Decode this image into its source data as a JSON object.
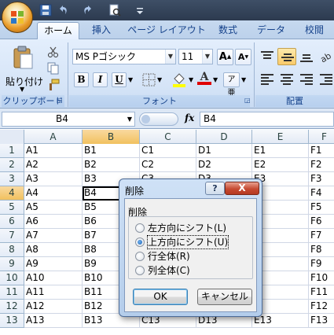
{
  "qat": {
    "icons": [
      "office-logo-icon",
      "save-icon",
      "undo-icon",
      "redo-icon",
      "print-preview-icon",
      "qat-customize-icon"
    ]
  },
  "tabs": [
    {
      "label": "ホーム",
      "active": true
    },
    {
      "label": "挿入",
      "active": false
    },
    {
      "label": "ページ レイアウト",
      "active": false
    },
    {
      "label": "数式",
      "active": false
    },
    {
      "label": "データ",
      "active": false
    },
    {
      "label": "校閲",
      "active": false
    }
  ],
  "ribbon": {
    "clipboard": {
      "paste_label": "貼り付け",
      "group_label": "クリップボード"
    },
    "font": {
      "font_name": "MS Pゴシック",
      "font_size": "11",
      "group_label": "フォント",
      "bold": "B",
      "italic": "I",
      "underline": "U"
    },
    "alignment": {
      "group_label": "配置"
    }
  },
  "formula_bar": {
    "name_box": "B4",
    "fx": "fx",
    "content": "B4"
  },
  "sheet": {
    "columns": [
      "A",
      "B",
      "C",
      "D",
      "E",
      "F"
    ],
    "selected_column": "B",
    "selected_row": "4",
    "active_cell": "B4",
    "rows": [
      {
        "num": "1",
        "cells": [
          "A1",
          "B1",
          "C1",
          "D1",
          "E1",
          "F1"
        ]
      },
      {
        "num": "2",
        "cells": [
          "A2",
          "B2",
          "C2",
          "D2",
          "E2",
          "F2"
        ]
      },
      {
        "num": "3",
        "cells": [
          "A3",
          "B3",
          "C3",
          "D3",
          "E3",
          "F3"
        ]
      },
      {
        "num": "4",
        "cells": [
          "A4",
          "B4",
          "",
          "",
          "",
          "F4"
        ]
      },
      {
        "num": "5",
        "cells": [
          "A5",
          "B5",
          "",
          "",
          "",
          "F5"
        ]
      },
      {
        "num": "6",
        "cells": [
          "A6",
          "B6",
          "",
          "",
          "",
          "F6"
        ]
      },
      {
        "num": "7",
        "cells": [
          "A7",
          "B7",
          "",
          "",
          "",
          "F7"
        ]
      },
      {
        "num": "8",
        "cells": [
          "A8",
          "B8",
          "",
          "",
          "",
          "F8"
        ]
      },
      {
        "num": "9",
        "cells": [
          "A9",
          "B9",
          "",
          "",
          "",
          "F9"
        ]
      },
      {
        "num": "10",
        "cells": [
          "A10",
          "B10",
          "",
          "",
          "0",
          "F10"
        ]
      },
      {
        "num": "11",
        "cells": [
          "A11",
          "B11",
          "",
          "",
          "1",
          "F11"
        ]
      },
      {
        "num": "12",
        "cells": [
          "A12",
          "B12",
          "",
          "",
          "2",
          "F12"
        ]
      },
      {
        "num": "13",
        "cells": [
          "A13",
          "B13",
          "C13",
          "D13",
          "E13",
          "F13"
        ]
      }
    ]
  },
  "dialog": {
    "title": "削除",
    "help": "?",
    "close": "X",
    "group_label": "削除",
    "options": [
      {
        "label": "左方向にシフト(L)",
        "selected": false
      },
      {
        "label": "上方向にシフト(U)",
        "selected": true
      },
      {
        "label": "行全体(R)",
        "selected": false
      },
      {
        "label": "列全体(C)",
        "selected": false
      }
    ],
    "ok": "OK",
    "cancel": "キャンセル"
  },
  "colors": {
    "ribbon_bg": "#dbe7f6",
    "selection_header": "#f6cd7a",
    "dialog_frame": "#b4cdeb",
    "close_button": "#c64a32"
  }
}
